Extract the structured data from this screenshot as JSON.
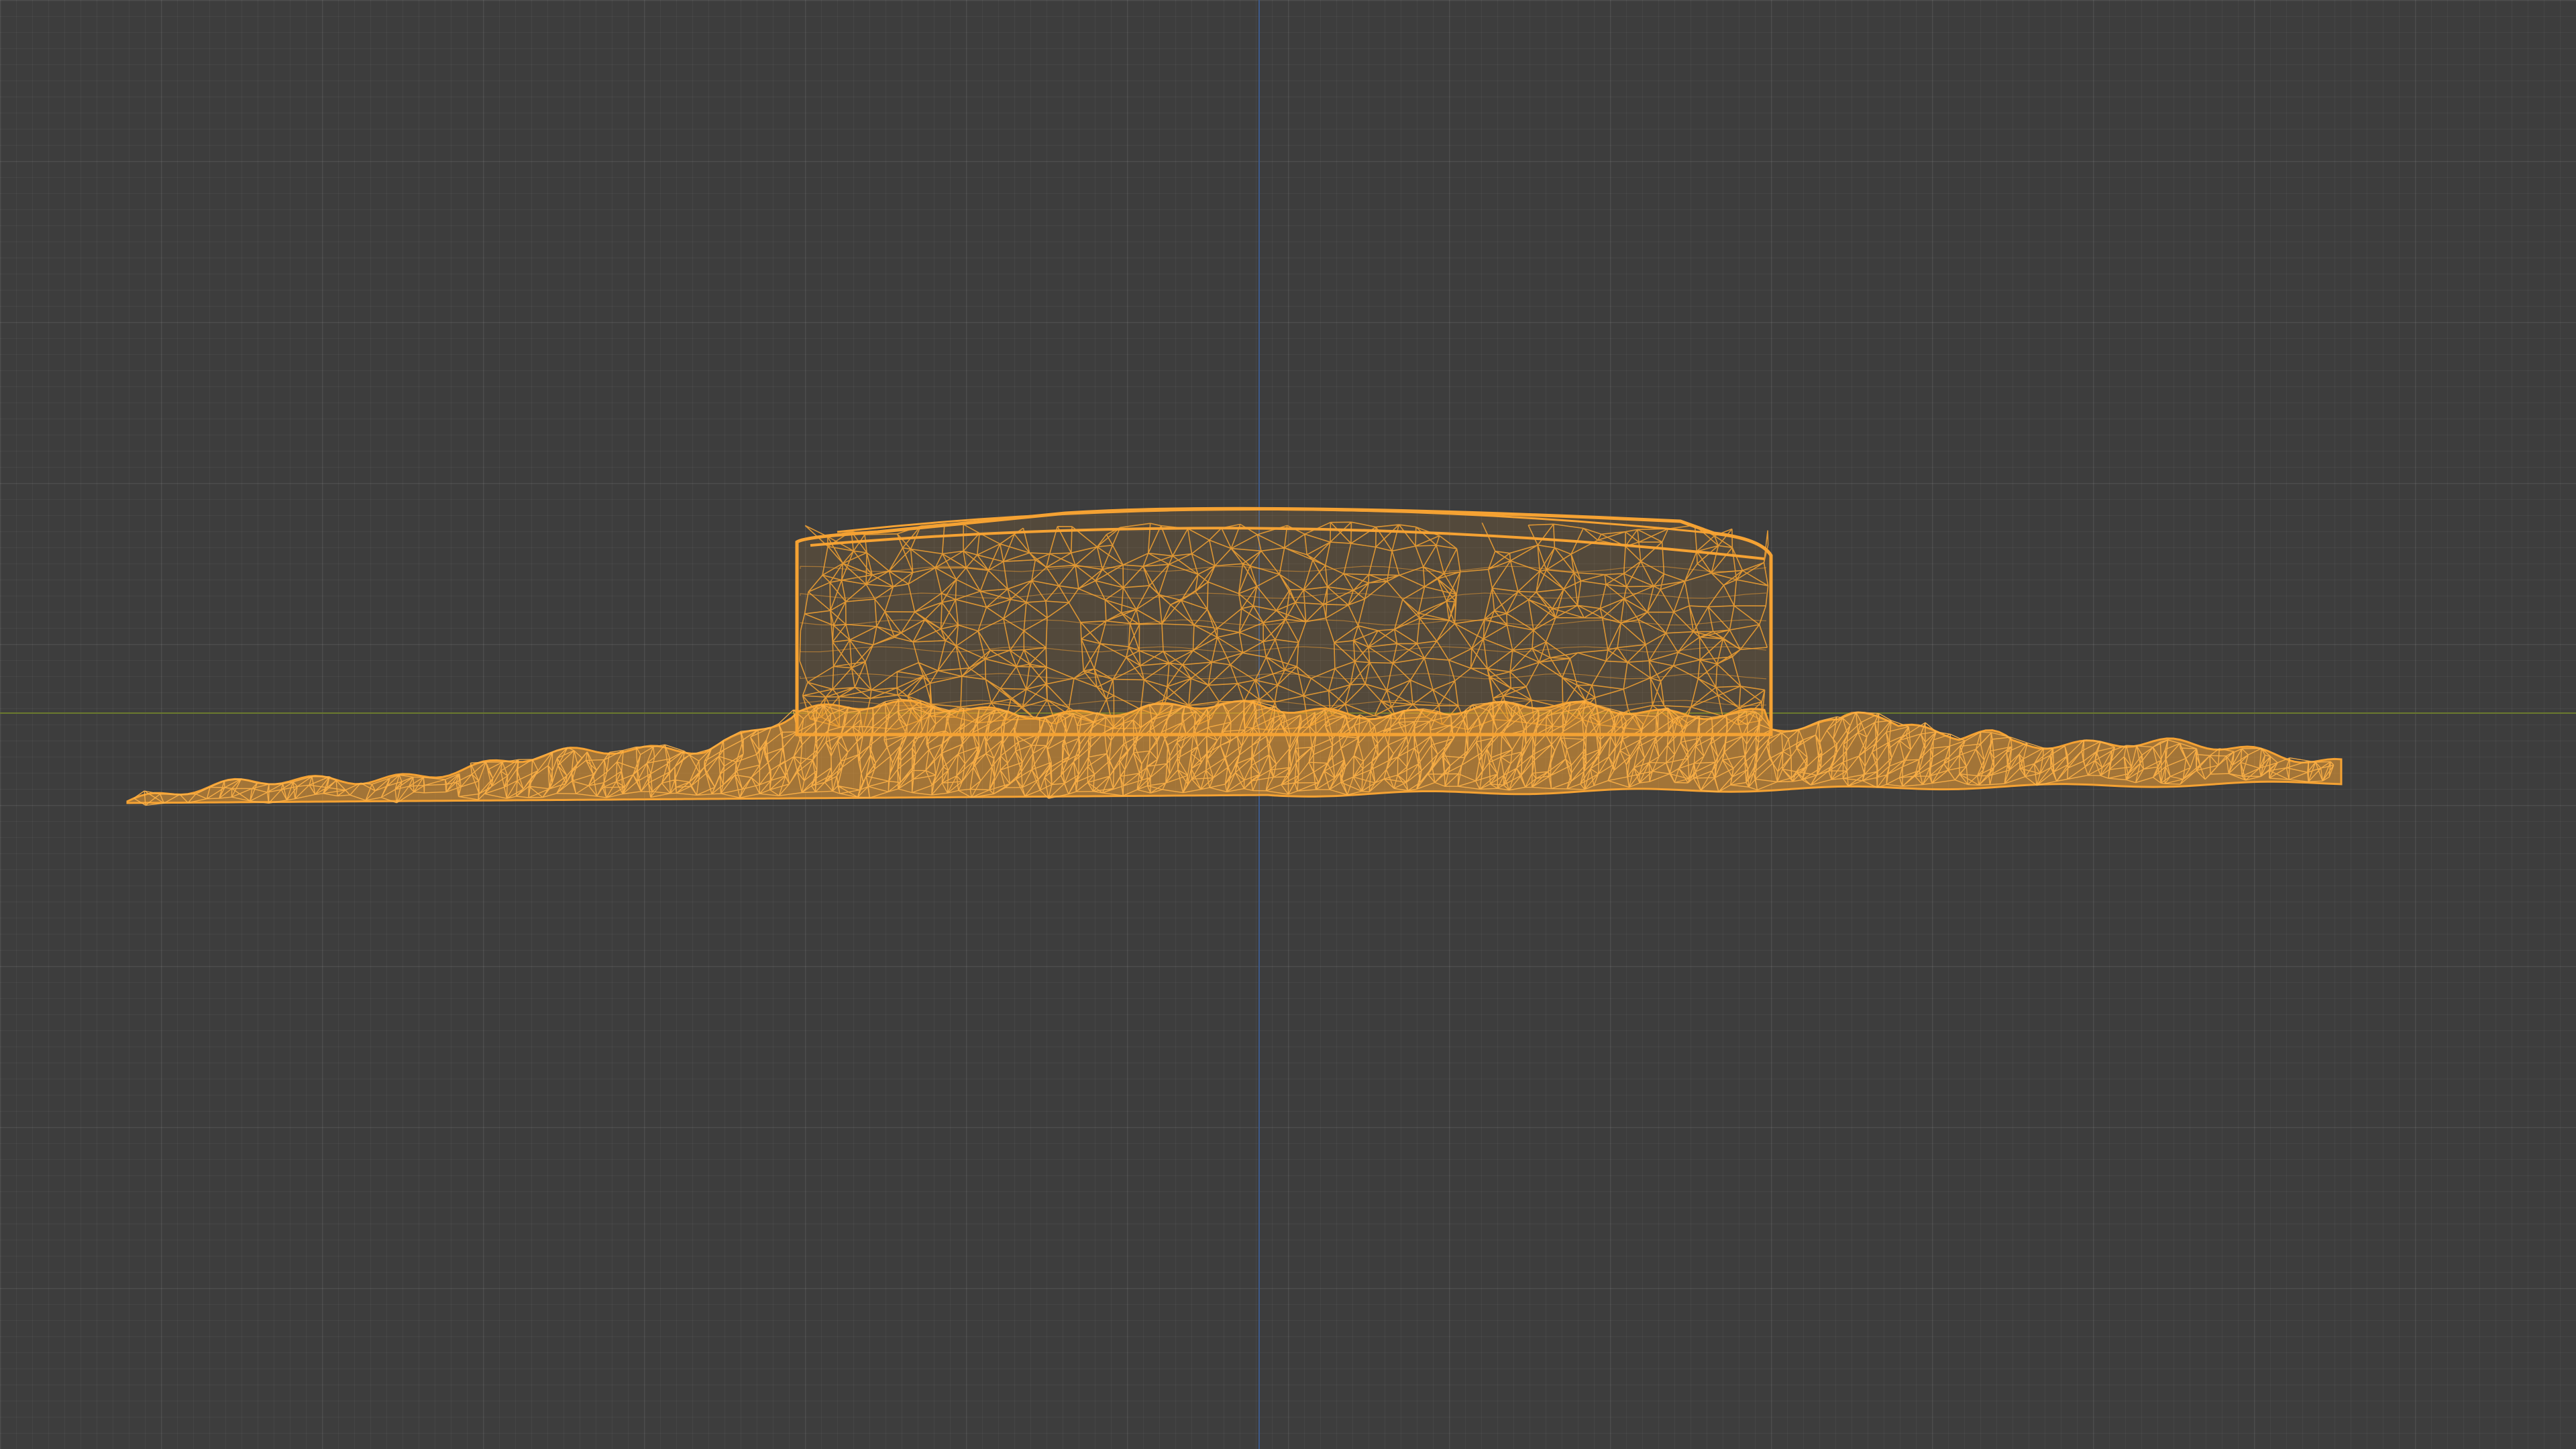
{
  "viewport": {
    "background_color": "#3d3d3d",
    "grid_color": "#4a4a4a",
    "x_axis_color": "#6b7a2e",
    "y_axis_color": "#3d5a8a"
  },
  "mesh": {
    "object": "scanned-mesh",
    "display_mode": "wireframe",
    "wire_color": "#f5a233",
    "selected": true
  }
}
